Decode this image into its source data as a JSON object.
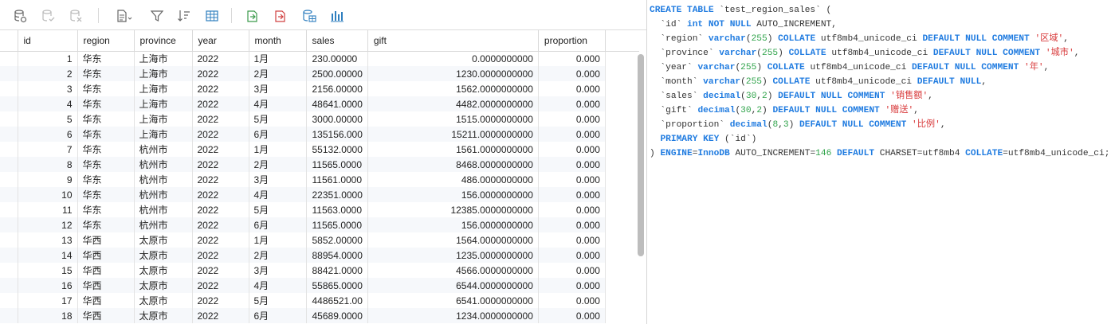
{
  "toolbar": {
    "buttons": [
      {
        "name": "refresh-data-icon"
      },
      {
        "name": "save-data-icon"
      },
      {
        "name": "discard-changes-icon"
      },
      {
        "name": "export-menu-icon"
      },
      {
        "name": "filter-icon"
      },
      {
        "name": "sort-icon"
      },
      {
        "name": "grid-view-icon"
      },
      {
        "name": "import-icon"
      },
      {
        "name": "export-icon"
      },
      {
        "name": "database-table-icon"
      },
      {
        "name": "chart-icon"
      }
    ],
    "accent_color": "#2f7fbf"
  },
  "grid": {
    "columns": [
      "id",
      "region",
      "province",
      "year",
      "month",
      "sales",
      "gift",
      "proportion"
    ],
    "rows": [
      [
        "1",
        "华东",
        "上海市",
        "2022",
        "1月",
        "230.00000",
        "0.0000000000",
        "0.000"
      ],
      [
        "2",
        "华东",
        "上海市",
        "2022",
        "2月",
        "2500.00000",
        "1230.0000000000",
        "0.000"
      ],
      [
        "3",
        "华东",
        "上海市",
        "2022",
        "3月",
        "2156.00000",
        "1562.0000000000",
        "0.000"
      ],
      [
        "4",
        "华东",
        "上海市",
        "2022",
        "4月",
        "48641.0000",
        "4482.0000000000",
        "0.000"
      ],
      [
        "5",
        "华东",
        "上海市",
        "2022",
        "5月",
        "3000.00000",
        "1515.0000000000",
        "0.000"
      ],
      [
        "6",
        "华东",
        "上海市",
        "2022",
        "6月",
        "135156.000",
        "15211.0000000000",
        "0.000"
      ],
      [
        "7",
        "华东",
        "杭州市",
        "2022",
        "1月",
        "55132.0000",
        "1561.0000000000",
        "0.000"
      ],
      [
        "8",
        "华东",
        "杭州市",
        "2022",
        "2月",
        "11565.0000",
        "8468.0000000000",
        "0.000"
      ],
      [
        "9",
        "华东",
        "杭州市",
        "2022",
        "3月",
        "11561.0000",
        "486.0000000000",
        "0.000"
      ],
      [
        "10",
        "华东",
        "杭州市",
        "2022",
        "4月",
        "22351.0000",
        "156.0000000000",
        "0.000"
      ],
      [
        "11",
        "华东",
        "杭州市",
        "2022",
        "5月",
        "11563.0000",
        "12385.0000000000",
        "0.000"
      ],
      [
        "12",
        "华东",
        "杭州市",
        "2022",
        "6月",
        "11565.0000",
        "156.0000000000",
        "0.000"
      ],
      [
        "13",
        "华西",
        "太原市",
        "2022",
        "1月",
        "5852.00000",
        "1564.0000000000",
        "0.000"
      ],
      [
        "14",
        "华西",
        "太原市",
        "2022",
        "2月",
        "88954.0000",
        "1235.0000000000",
        "0.000"
      ],
      [
        "15",
        "华西",
        "太原市",
        "2022",
        "3月",
        "88421.0000",
        "4566.0000000000",
        "0.000"
      ],
      [
        "16",
        "华西",
        "太原市",
        "2022",
        "4月",
        "55865.0000",
        "6544.0000000000",
        "0.000"
      ],
      [
        "17",
        "华西",
        "太原市",
        "2022",
        "5月",
        "4486521.00",
        "6541.0000000000",
        "0.000"
      ],
      [
        "18",
        "华西",
        "太原市",
        "2022",
        "6月",
        "45689.0000",
        "1234.0000000000",
        "0.000"
      ]
    ]
  },
  "ddl": {
    "lines": [
      [
        [
          "kw",
          "CREATE TABLE "
        ],
        [
          "pl",
          "`test_region_sales` ("
        ]
      ],
      [
        [
          "pl",
          "  `id` "
        ],
        [
          "ty",
          "int NOT NULL "
        ],
        [
          "pl",
          "AUTO_INCREMENT,"
        ]
      ],
      [
        [
          "pl",
          "  `region` "
        ],
        [
          "ty",
          "varchar"
        ],
        [
          "pl",
          "("
        ],
        [
          "nm",
          "255"
        ],
        [
          "pl",
          ") "
        ],
        [
          "kw",
          "COLLATE "
        ],
        [
          "pl",
          "utf8mb4_unicode_ci "
        ],
        [
          "kw",
          "DEFAULT NULL COMMENT "
        ],
        [
          "str",
          "'区域'"
        ],
        [
          "pl",
          ","
        ]
      ],
      [
        [
          "pl",
          "  `province` "
        ],
        [
          "ty",
          "varchar"
        ],
        [
          "pl",
          "("
        ],
        [
          "nm",
          "255"
        ],
        [
          "pl",
          ") "
        ],
        [
          "kw",
          "COLLATE "
        ],
        [
          "pl",
          "utf8mb4_unicode_ci "
        ],
        [
          "kw",
          "DEFAULT NULL COMMENT "
        ],
        [
          "str",
          "'城市'"
        ],
        [
          "pl",
          ","
        ]
      ],
      [
        [
          "pl",
          "  `year` "
        ],
        [
          "ty",
          "varchar"
        ],
        [
          "pl",
          "("
        ],
        [
          "nm",
          "255"
        ],
        [
          "pl",
          ") "
        ],
        [
          "kw",
          "COLLATE "
        ],
        [
          "pl",
          "utf8mb4_unicode_ci "
        ],
        [
          "kw",
          "DEFAULT NULL COMMENT "
        ],
        [
          "str",
          "'年'"
        ],
        [
          "pl",
          ","
        ]
      ],
      [
        [
          "pl",
          "  `month` "
        ],
        [
          "ty",
          "varchar"
        ],
        [
          "pl",
          "("
        ],
        [
          "nm",
          "255"
        ],
        [
          "pl",
          ") "
        ],
        [
          "kw",
          "COLLATE "
        ],
        [
          "pl",
          "utf8mb4_unicode_ci "
        ],
        [
          "kw",
          "DEFAULT NULL"
        ],
        [
          "pl",
          ","
        ]
      ],
      [
        [
          "pl",
          "  `sales` "
        ],
        [
          "ty",
          "decimal"
        ],
        [
          "pl",
          "("
        ],
        [
          "nm",
          "30"
        ],
        [
          "pl",
          ","
        ],
        [
          "nm",
          "2"
        ],
        [
          "pl",
          ") "
        ],
        [
          "kw",
          "DEFAULT NULL COMMENT "
        ],
        [
          "str",
          "'销售额'"
        ],
        [
          "pl",
          ","
        ]
      ],
      [
        [
          "pl",
          "  `gift` "
        ],
        [
          "ty",
          "decimal"
        ],
        [
          "pl",
          "("
        ],
        [
          "nm",
          "30"
        ],
        [
          "pl",
          ","
        ],
        [
          "nm",
          "2"
        ],
        [
          "pl",
          ") "
        ],
        [
          "kw",
          "DEFAULT NULL COMMENT "
        ],
        [
          "str",
          "'赠送'"
        ],
        [
          "pl",
          ","
        ]
      ],
      [
        [
          "pl",
          "  `proportion` "
        ],
        [
          "ty",
          "decimal"
        ],
        [
          "pl",
          "("
        ],
        [
          "nm",
          "8"
        ],
        [
          "pl",
          ","
        ],
        [
          "nm",
          "3"
        ],
        [
          "pl",
          ") "
        ],
        [
          "kw",
          "DEFAULT NULL COMMENT "
        ],
        [
          "str",
          "'比例'"
        ],
        [
          "pl",
          ","
        ]
      ],
      [
        [
          "pl",
          "  "
        ],
        [
          "kw",
          "PRIMARY KEY "
        ],
        [
          "pl",
          "(`id`)"
        ]
      ],
      [
        [
          "pl",
          ") "
        ],
        [
          "kw",
          "ENGINE"
        ],
        [
          "pl",
          "="
        ],
        [
          "kw",
          "InnoDB "
        ],
        [
          "pl",
          "AUTO_INCREMENT="
        ],
        [
          "nm",
          "146 "
        ],
        [
          "kw",
          "DEFAULT "
        ],
        [
          "pl",
          "CHARSET=utf8mb4 "
        ],
        [
          "kw",
          "COLLATE"
        ],
        [
          "pl",
          "=utf8mb4_unicode_ci;"
        ]
      ]
    ]
  }
}
